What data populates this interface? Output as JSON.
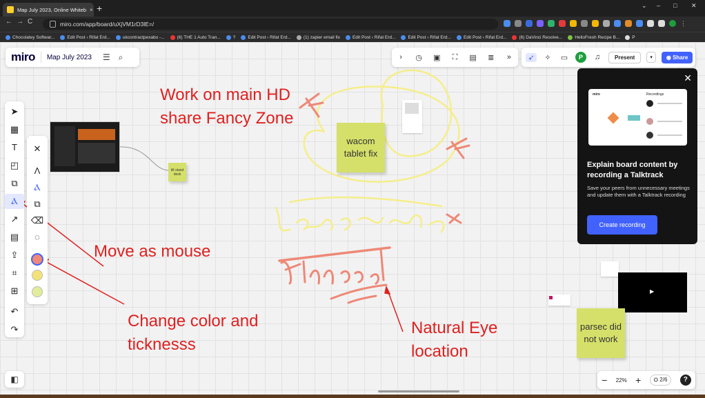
{
  "browser": {
    "tab_title": "Map July 2023, Online Whitebo...",
    "tab_close": "×",
    "new_tab": "+",
    "window_controls": [
      "⌄",
      "–",
      "□",
      "✕"
    ],
    "url": "miro.com/app/board/uXjVM1rD3lE=/",
    "bookmarks": [
      "Chocolatey Softwar...",
      "Edit Post ‹ Rifat Erd...",
      "ukcontractpexabo -...",
      "(6) THE 1 Auto Tran...",
      "?",
      "Edit Post ‹ Rifat Erd...",
      "(1) zapier email fix",
      "Edit Post ‹ Rifat Erd...",
      "Edit Post ‹ Rifat Erd...",
      "Edit Post ‹ Rifat Erd...",
      "(6) DaVinci Resolve...",
      "HelloFresh Recipe B...",
      "P"
    ]
  },
  "miro": {
    "logo": "miro",
    "board_title": "Map July 2023",
    "present_label": "Present",
    "share_label": "Share",
    "avatar_initial": "P",
    "zoom": "22%",
    "pages": "2/6",
    "help": "?"
  },
  "popup": {
    "title": "Explain board content by recording a Talktrack",
    "body": "Save your peers from unnecessary meetings and update them with a Talktrack recording",
    "button": "Create recording",
    "preview_left": "miro",
    "preview_right": "Recordings"
  },
  "stickies": {
    "wacom": "wacom tablet fix",
    "parsec": "parsec did not work",
    "small": "tilt stand desk"
  },
  "annotations": {
    "work": "Work on main HD share Fancy Zone",
    "move": "Move as mouse",
    "change": "Change color and ticknesss",
    "natural": "Natural Eye location"
  },
  "colors": {
    "accent": "#4262ff",
    "annotation": "#e02020",
    "sticky": "#d5e06a",
    "pen_salmon": "#ee8877",
    "highlight_yellow": "#f5ee8a"
  },
  "icons": {
    "tools": [
      "select-icon",
      "frame-template-icon",
      "text-icon",
      "sticky-note-icon",
      "shapes-icon",
      "pen-icon",
      "connector-icon",
      "comment-icon",
      "upload-icon",
      "frame-icon",
      "add-icon",
      "undo-icon",
      "redo-icon"
    ]
  }
}
